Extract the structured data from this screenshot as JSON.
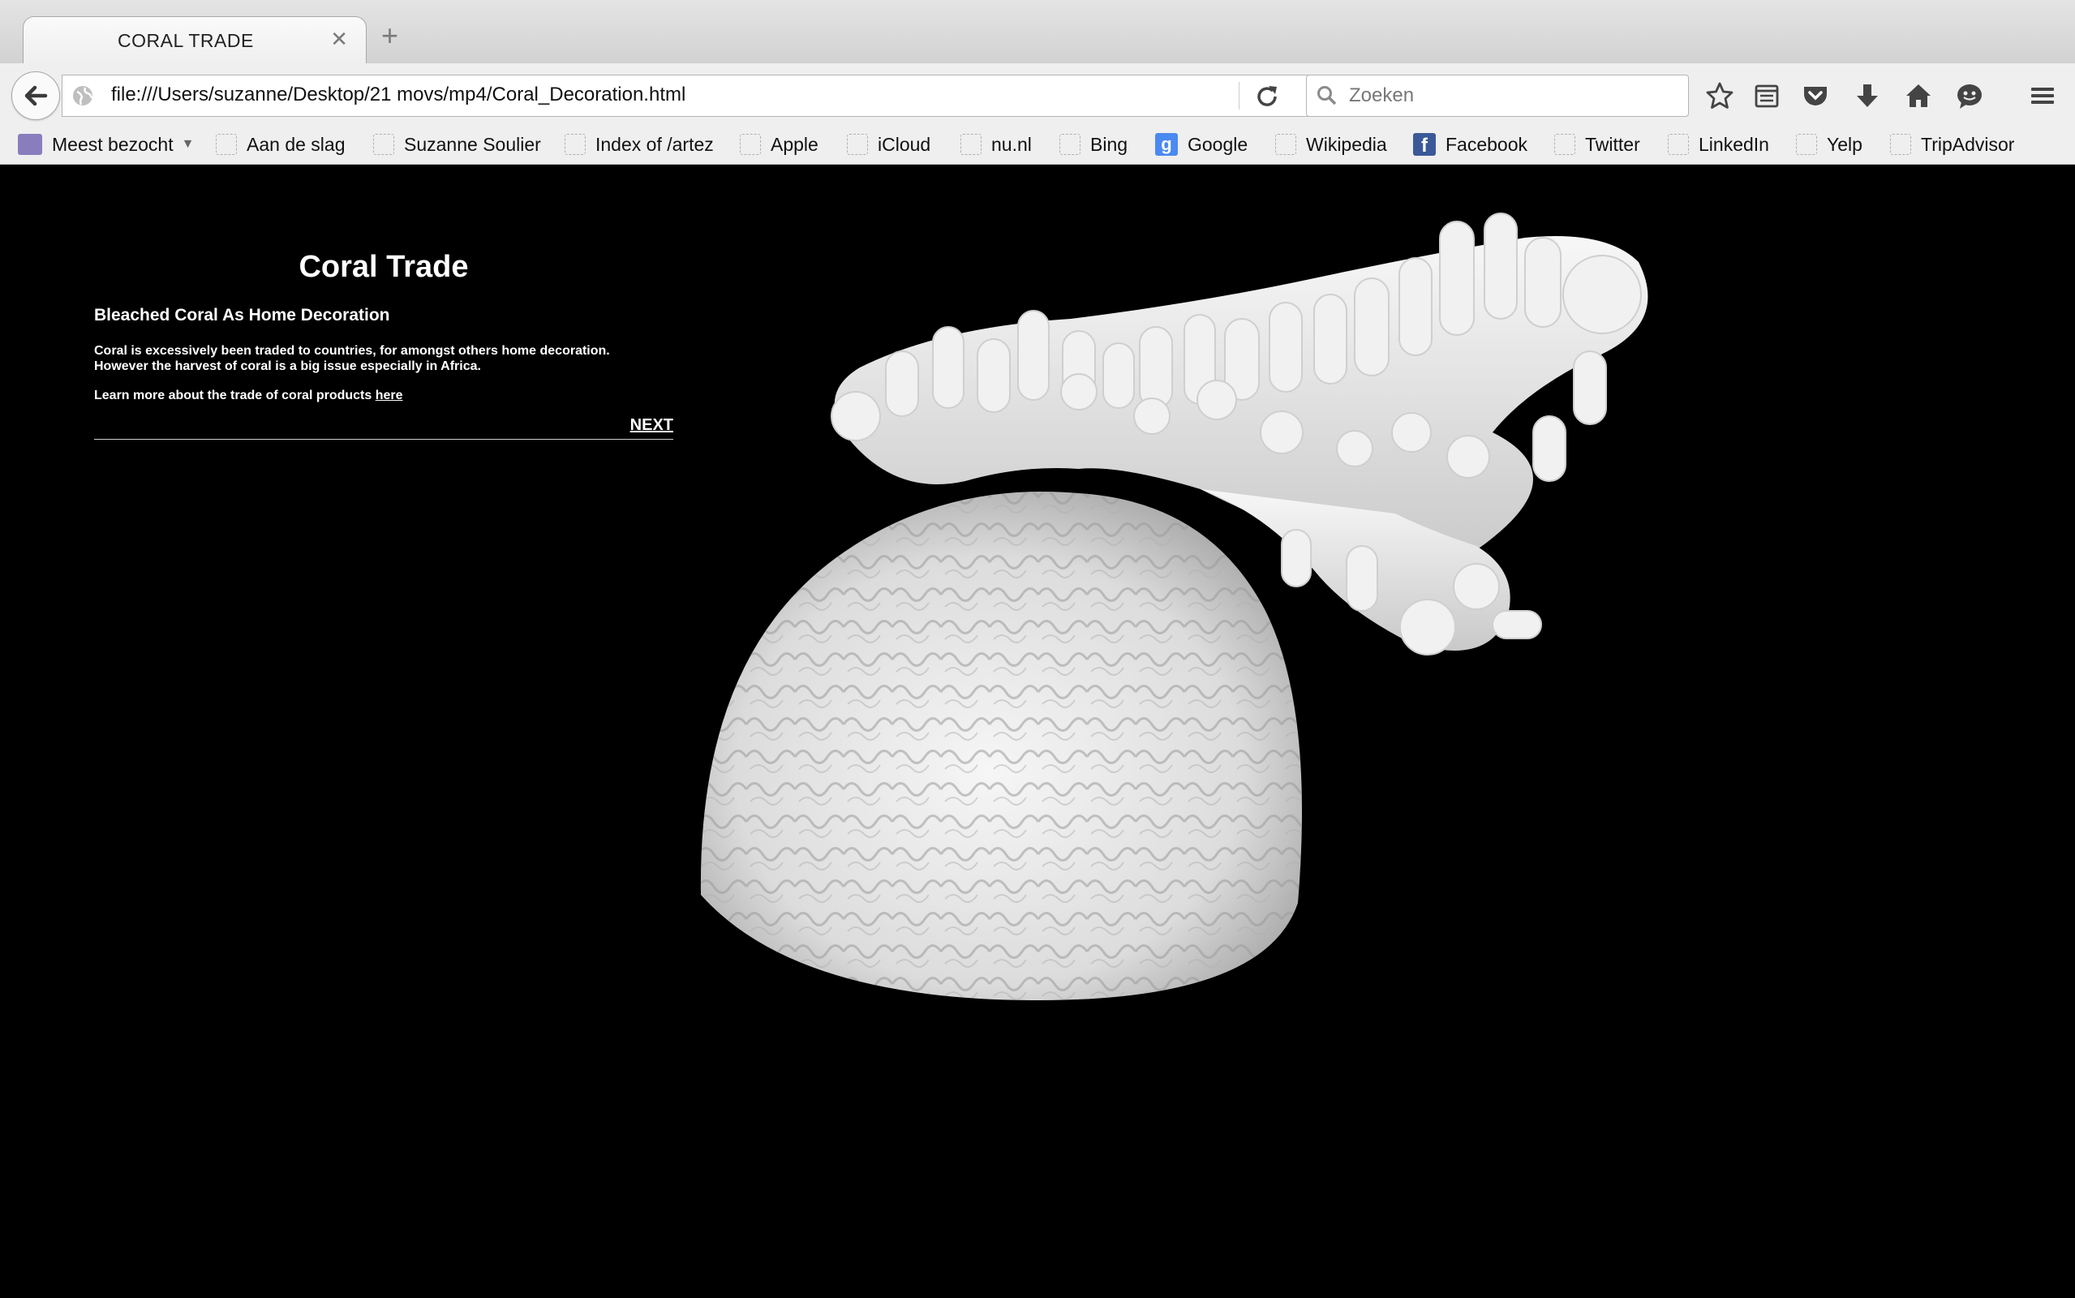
{
  "tab": {
    "title": "CORAL TRADE"
  },
  "navbar": {
    "url": "file:///Users/suzanne/Desktop/21 movs/mp4/Coral_Decoration.html",
    "search_placeholder": "Zoeken"
  },
  "bookmarks": [
    {
      "label": "Meest bezocht"
    },
    {
      "label": "Aan de slag"
    },
    {
      "label": "Suzanne Soulier"
    },
    {
      "label": "Index of /artez"
    },
    {
      "label": "Apple"
    },
    {
      "label": "iCloud"
    },
    {
      "label": "nu.nl"
    },
    {
      "label": "Bing"
    },
    {
      "label": "Google"
    },
    {
      "label": "Wikipedia"
    },
    {
      "label": "Facebook"
    },
    {
      "label": "Twitter"
    },
    {
      "label": "LinkedIn"
    },
    {
      "label": "Yelp"
    },
    {
      "label": "TripAdvisor"
    }
  ],
  "page": {
    "title": "Coral Trade",
    "subtitle": "Bleached Coral As Home Decoration",
    "paragraph_line1": "Coral is excessively been traded to countries, for amongst others home decoration.",
    "paragraph_line2": "However the harvest of coral is a big issue especially in Africa.",
    "learn_more": "Learn more about the trade of coral products ",
    "link_text": "here",
    "next_label": "NEXT"
  }
}
